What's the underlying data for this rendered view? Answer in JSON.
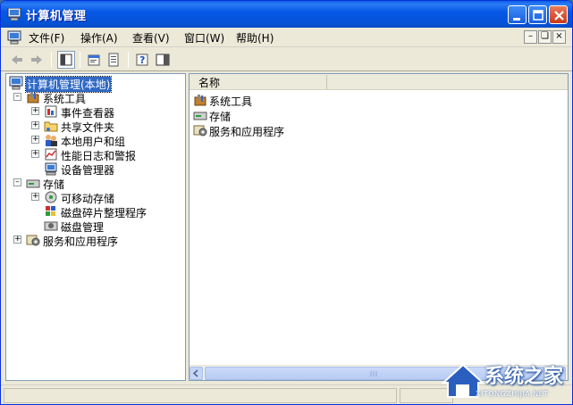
{
  "window": {
    "title": "计算机管理"
  },
  "menu": {
    "items": [
      {
        "label": "文件(F)"
      },
      {
        "label": "操作(A)"
      },
      {
        "label": "查看(V)"
      },
      {
        "label": "窗口(W)"
      },
      {
        "label": "帮助(H)"
      }
    ]
  },
  "tree": {
    "root": "计算机管理(本地)",
    "system_tools": "系统工具",
    "event_viewer": "事件查看器",
    "shared_folders": "共享文件夹",
    "local_users": "本地用户和组",
    "perf_logs": "性能日志和警报",
    "device_manager": "设备管理器",
    "storage": "存储",
    "removable_storage": "可移动存储",
    "defrag": "磁盘碎片整理程序",
    "disk_mgmt": "磁盘管理",
    "services_apps": "服务和应用程序"
  },
  "list": {
    "column_name": "名称",
    "items": [
      {
        "label": "系统工具"
      },
      {
        "label": "存储"
      },
      {
        "label": "服务和应用程序"
      }
    ]
  },
  "watermark": {
    "text": "系统之家",
    "url": "XITONGZHIJIA.NET"
  }
}
